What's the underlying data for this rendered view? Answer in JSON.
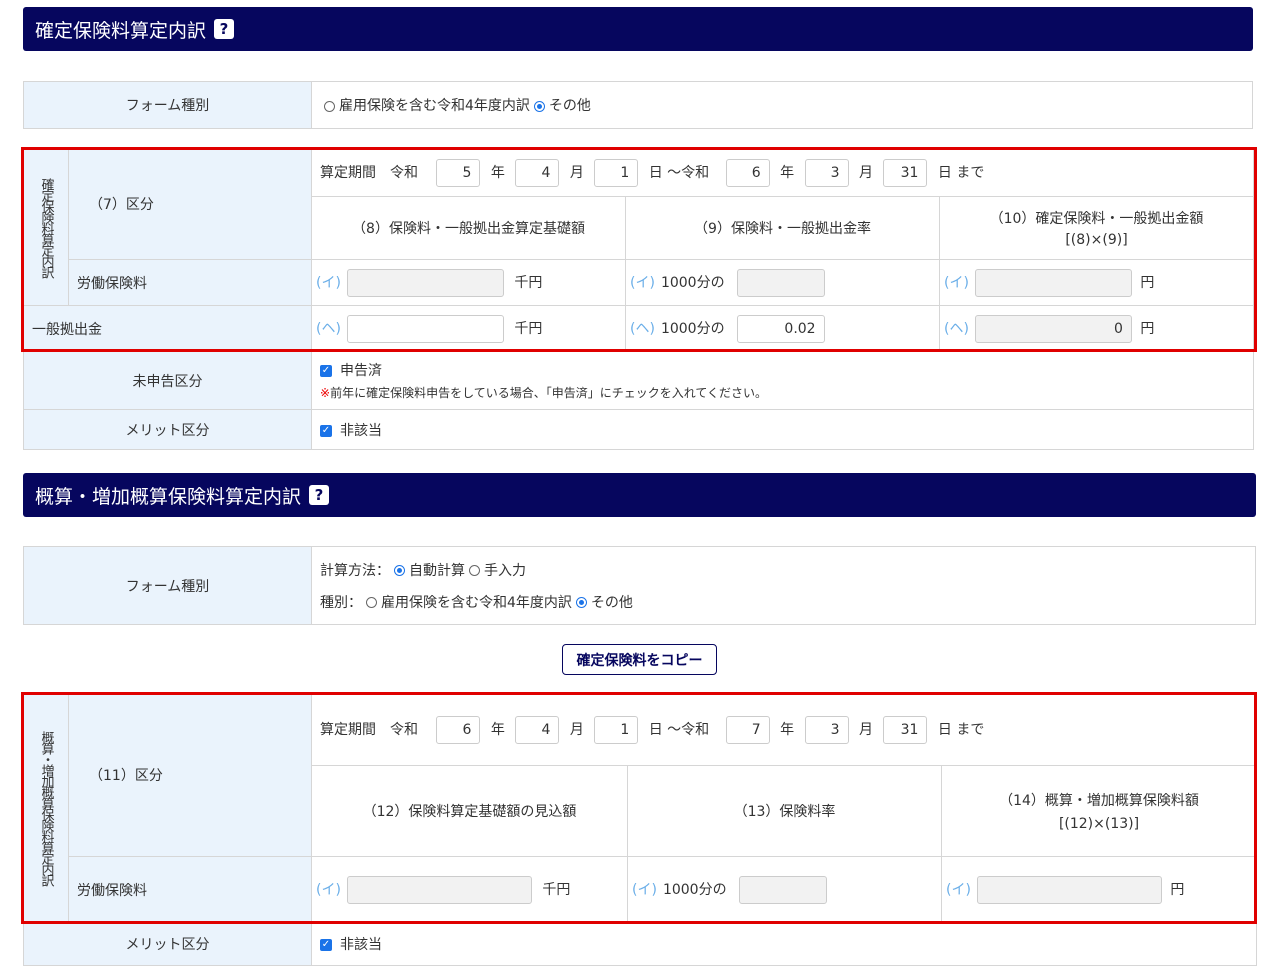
{
  "s1": {
    "title": "確定保険料算定内訳",
    "help": "?",
    "form_label": "フォーム種別",
    "opt1": "雇用保険を含む令和4年度内訳",
    "opt2": "その他",
    "vert": "確定保険料算定内訳",
    "kubun": "（7）区分",
    "period": {
      "label": "算定期間",
      "era": "令和",
      "y1": "5",
      "m1": "4",
      "d1": "1",
      "tilde": "日 ～令和",
      "y2": "6",
      "m2": "3",
      "d2": "31",
      "until": "日 まで",
      "nen": "年",
      "tsuki": "月"
    },
    "h8": "（8）保険料・一般拠出金算定基礎額",
    "h9": "（9）保険料・一般拠出金率",
    "h10": "（10）確定保険料・一般拠出金額",
    "h10b": "[(8)×(9)]",
    "labor": "労働保険料",
    "general": "一般拠出金",
    "i": "(イ)",
    "he": "(ヘ)",
    "senen": "千円",
    "rate": "1000分の",
    "en": "円",
    "general_rate": "0.02",
    "general_amount": "0",
    "mishinkoku": "未申告区分",
    "shinkoku_done": "申告済",
    "note_mark": "※",
    "note": "前年に確定保険料申告をしている場合、「申告済」にチェックを入れてください。",
    "merit": "メリット区分",
    "higaito": "非該当"
  },
  "s2": {
    "title": "概算・増加概算保険料算定内訳",
    "help": "?",
    "form_label": "フォーム種別",
    "calc_label": "計算方法：",
    "auto": "自動計算",
    "manual": "手入力",
    "type_label": "種別：",
    "opt1": "雇用保険を含む令和4年度内訳",
    "opt2": "その他",
    "copy": "確定保険料をコピー",
    "vert": "概算・増加概算保険料算定内訳",
    "kubun": "（11）区分",
    "period": {
      "label": "算定期間",
      "era": "令和",
      "y1": "6",
      "m1": "4",
      "d1": "1",
      "tilde": "日 ～令和",
      "y2": "7",
      "m2": "3",
      "d2": "31",
      "until": "日 まで",
      "nen": "年",
      "tsuki": "月"
    },
    "h12": "（12）保険料算定基礎額の見込額",
    "h13": "（13）保険料率",
    "h14": "（14）概算・増加概算保険料額",
    "h14b": "[(12)×(13)]",
    "labor": "労働保険料",
    "i": "(イ)",
    "senen": "千円",
    "rate": "1000分の",
    "en": "円",
    "merit": "メリット区分",
    "higaito": "非該当"
  }
}
